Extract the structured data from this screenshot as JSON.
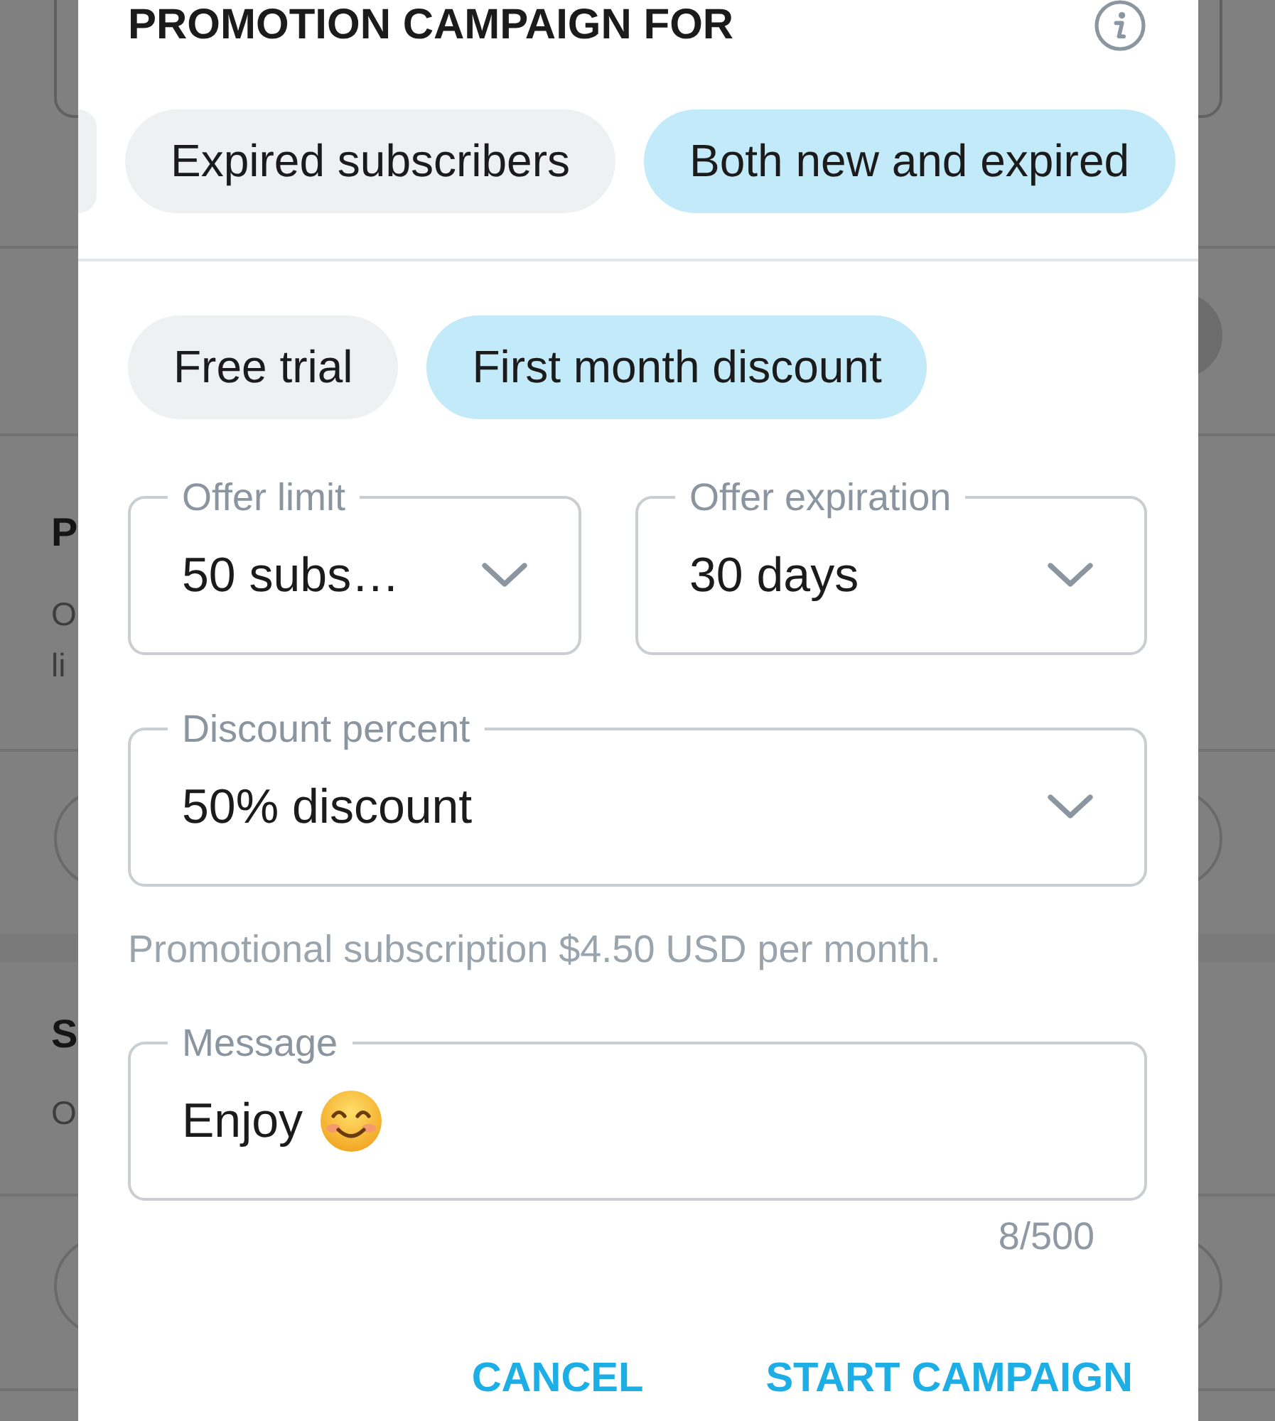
{
  "background": {
    "sections": [
      {
        "title": "P",
        "lines": [
          "O",
          "li"
        ]
      },
      {
        "title": "S",
        "lines": [
          "O"
        ]
      }
    ]
  },
  "dialog": {
    "title": "PROMOTION CAMPAIGN FOR",
    "audience_chips": [
      {
        "selected": false
      },
      {
        "label": "Expired subscribers",
        "selected": false
      },
      {
        "label": "Both new and expired",
        "selected": true
      }
    ],
    "offer_chips": [
      {
        "label": "Free trial",
        "selected": false
      },
      {
        "label": "First month discount",
        "selected": true
      }
    ],
    "field_rows": [
      {
        "fields": [
          {
            "label": "Offer limit",
            "value": "50 subs…"
          },
          {
            "label": "Offer expiration",
            "value": "30 days"
          }
        ]
      },
      {
        "fields": [
          {
            "label": "Discount percent",
            "value": "50% discount"
          }
        ]
      }
    ],
    "helper_text": "Promotional subscription $4.50 USD per month.",
    "message": {
      "label": "Message",
      "value": "Enjoy",
      "counter": "8/500"
    },
    "buttons": [
      "CANCEL",
      "START CAMPAIGN"
    ]
  }
}
